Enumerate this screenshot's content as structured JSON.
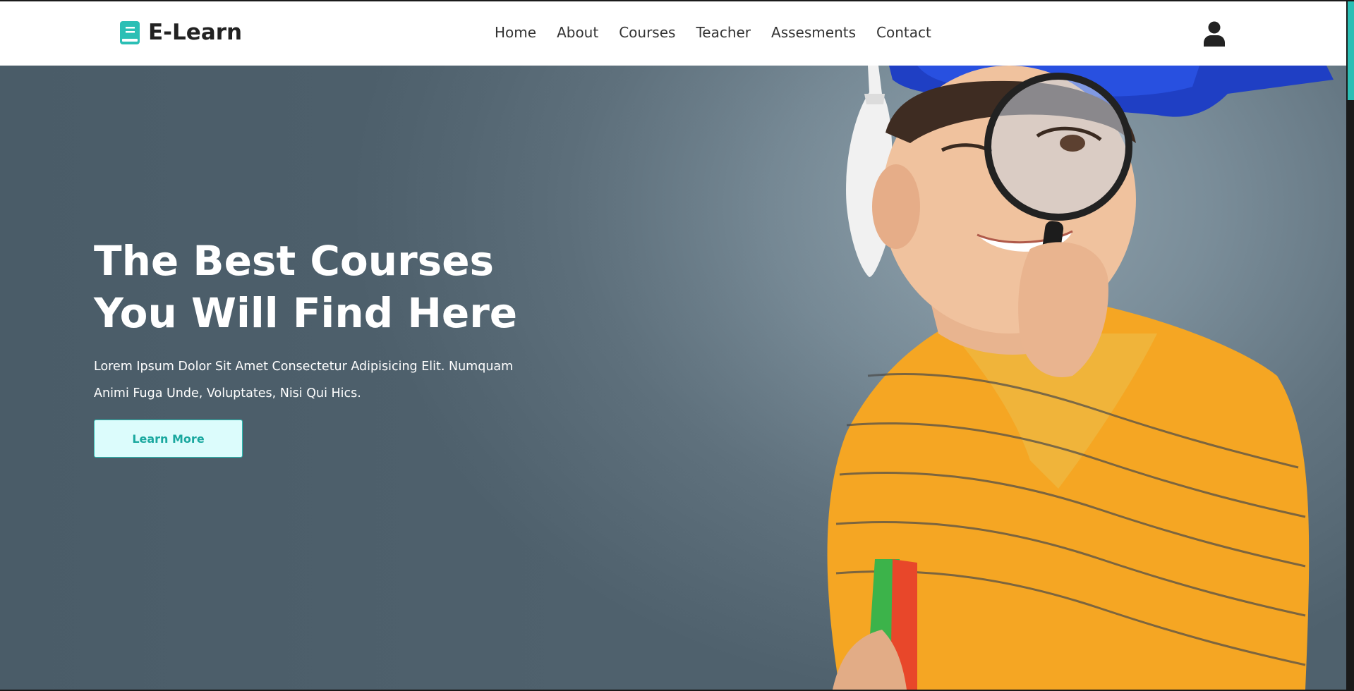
{
  "brand": {
    "name": "E-Learn",
    "accent": "#2bbfb5"
  },
  "nav": {
    "items": [
      {
        "label": "Home"
      },
      {
        "label": "About"
      },
      {
        "label": "Courses"
      },
      {
        "label": "Teacher"
      },
      {
        "label": "Assesments"
      },
      {
        "label": "Contact"
      }
    ]
  },
  "header": {
    "user_icon": "user-icon",
    "logo_icon": "book-icon"
  },
  "hero": {
    "title_line1": "The Best Courses",
    "title_line2": "You Will Find Here",
    "description_line1": "Lorem Ipsum Dolor Sit Amet Consectetur Adipisicing Elit. Numquam",
    "description_line2": "Animi Fuga Unde, Voluptates, Nisi Qui Hics.",
    "button_label": "Learn More"
  }
}
